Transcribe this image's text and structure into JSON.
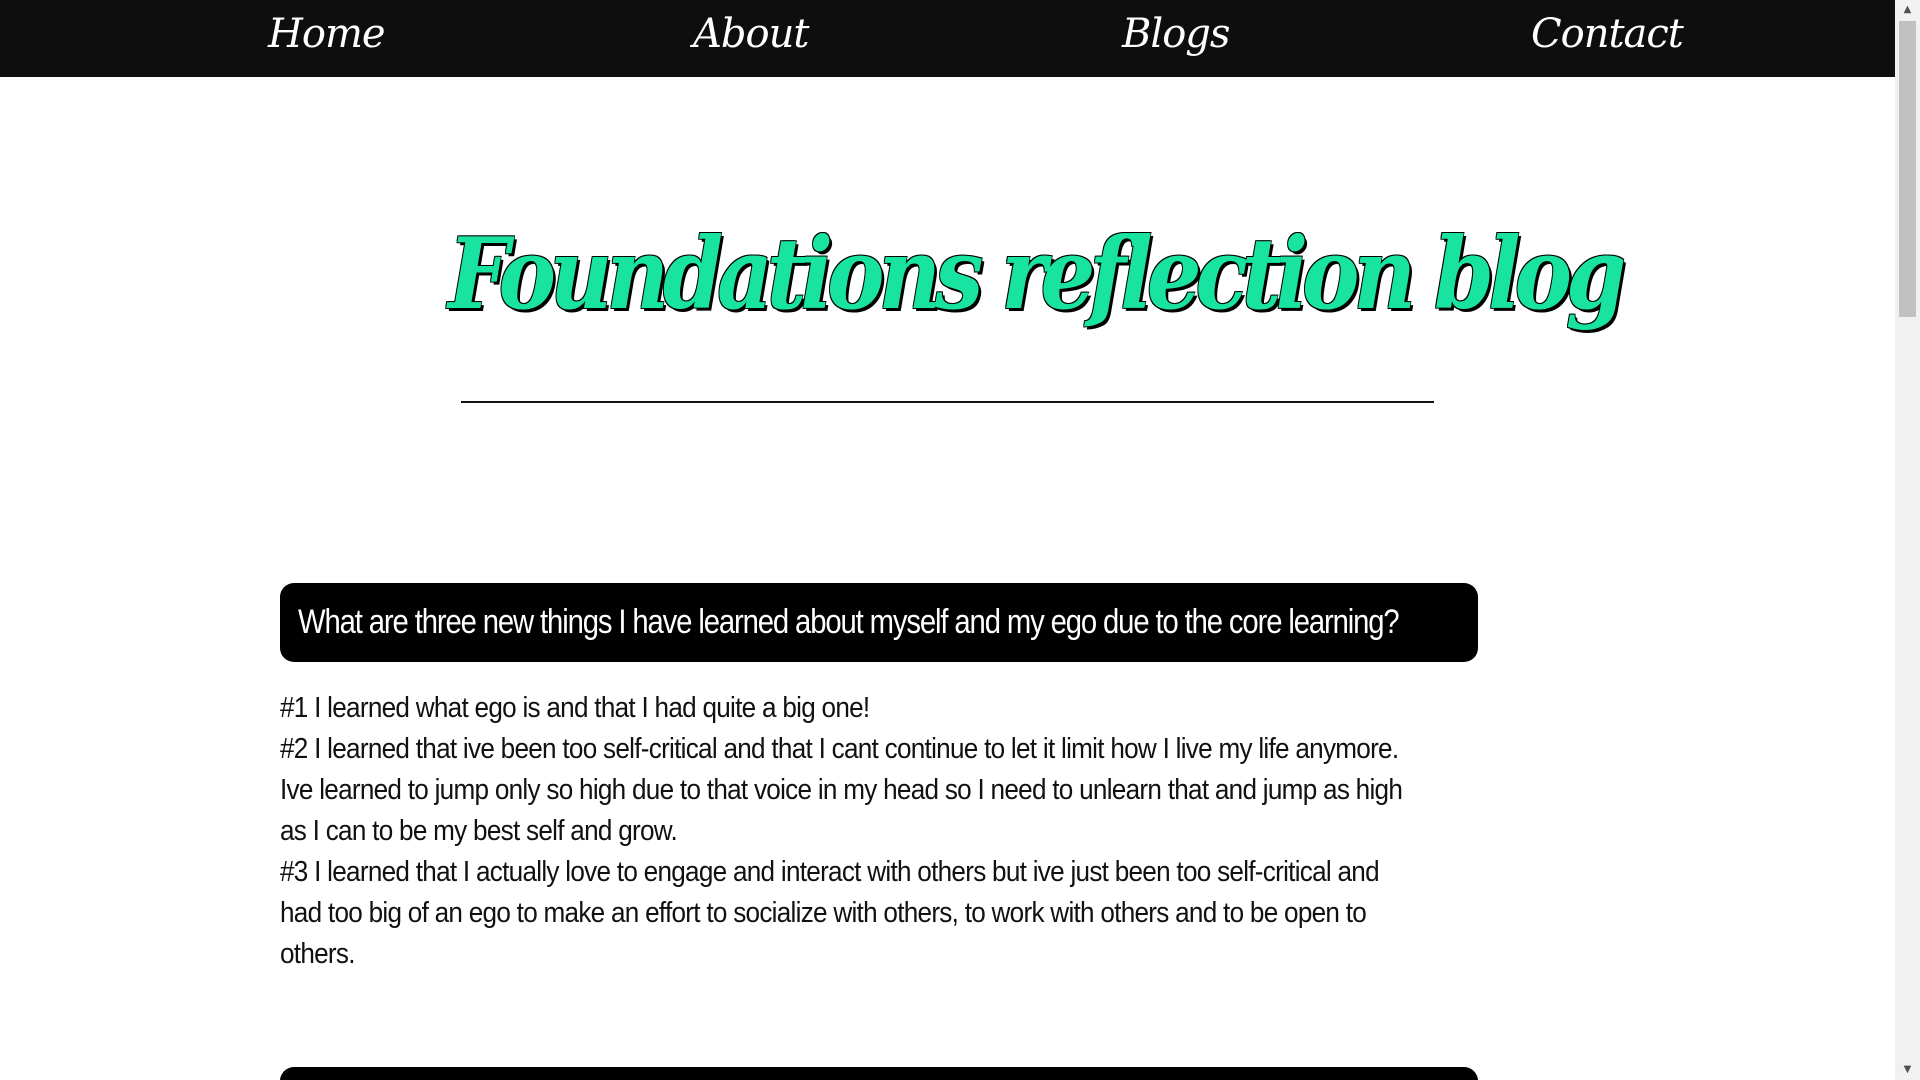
{
  "nav": {
    "items": [
      {
        "label": "Home"
      },
      {
        "label": "About"
      },
      {
        "label": "Blogs"
      },
      {
        "label": "Contact"
      }
    ]
  },
  "hero": {
    "title": "Foundations reflection blog"
  },
  "post": {
    "question": "What are three new things I have learned about myself and my ego due to the core learning?",
    "answer_lines": [
      "#1 I learned what ego is and that I had quite a big one!",
      "#2 I learned that ive been too self-critical and that I cant continue to let it limit how I live my life anymore.",
      "Ive learned to jump only so high due to that voice in my head so I need to unlearn that and jump as high",
      "as I can to be my best self and grow.",
      "#3 I learned that I actually love to engage and interact with others but ive just been too self-critical and",
      "had too big of an ego to make an effort to socialize with others, to work with others and to be open to",
      "others."
    ]
  },
  "colors": {
    "nav_background": "#0e0e0e",
    "title_accent": "#19e3a0",
    "card_background": "#000000",
    "text": "#111111"
  },
  "icons": {
    "scroll_up": "triangle-up-icon",
    "scroll_down": "triangle-down-icon"
  }
}
